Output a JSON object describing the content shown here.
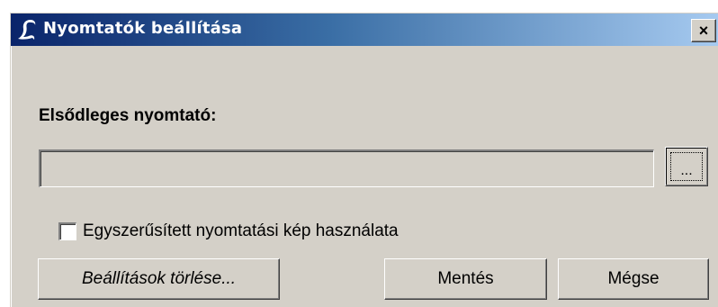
{
  "window": {
    "title": "Nyomtatók beállítása",
    "close_symbol": "×",
    "app_icon": "lexikon-L-icon"
  },
  "form": {
    "printer_label": "Elsődleges nyomtató:",
    "printer_path_value": "",
    "browse_label": "...",
    "checkbox_label": "Egyszerűsített nyomtatási kép használata",
    "checkbox_checked": false
  },
  "buttons": {
    "reset_label": "Beállítások törlése...",
    "save_label": "Mentés",
    "cancel_label": "Mégse"
  },
  "colors": {
    "titlebar_start": "#0a246a",
    "titlebar_end": "#a6caf0",
    "dialog_face": "#d4d0c8"
  }
}
